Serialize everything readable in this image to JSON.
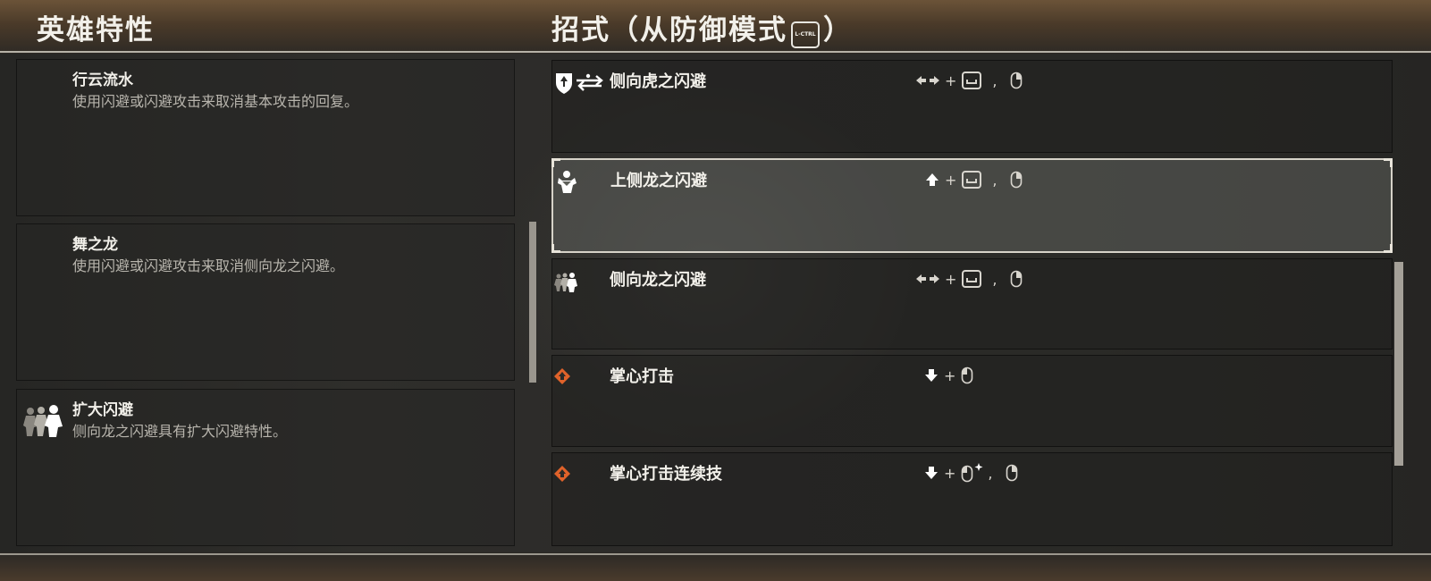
{
  "headers": {
    "traits_title": "英雄特性",
    "moves_title_prefix": "招式（从防御模式",
    "moves_title_key": "L-CTRL",
    "moves_title_suffix": "）"
  },
  "traits": [
    {
      "name": "行云流水",
      "description": "使用闪避或闪避攻击来取消基本攻击的回复。",
      "icon": ""
    },
    {
      "name": "舞之龙",
      "description": "使用闪避或闪避攻击来取消侧向龙之闪避。",
      "icon": ""
    },
    {
      "name": "扩大闪避",
      "description": "侧向龙之闪避具有扩大闪避特性。",
      "icon": "dodge-figures-icon"
    }
  ],
  "moves": [
    {
      "name": "侧向虎之闪避",
      "icon": "shield-dodge-icon",
      "inputs": "left-right-arrows + space-key , right-mouse-button",
      "highlighted": false
    },
    {
      "name": "上侧龙之闪避",
      "icon": "dragon-figure-icon",
      "inputs": "up-arrow + space-key , right-mouse-button",
      "highlighted": true
    },
    {
      "name": "侧向龙之闪避",
      "icon": "dodge-figures-icon",
      "inputs": "left-right-arrows + space-key , right-mouse-button",
      "highlighted": false
    },
    {
      "name": "掌心打击",
      "icon": "orange-palm-strike-icon",
      "inputs": "down-arrow + mouse-button",
      "highlighted": false
    },
    {
      "name": "掌心打击连续技",
      "icon": "orange-palm-strike-icon",
      "inputs": "down-arrow + mouse-button(hold) , right-mouse-button",
      "highlighted": false
    }
  ],
  "colors": {
    "accent_orange": "#e0622a",
    "header_text": "#f2f0ea",
    "description_text": "#b8b5ad"
  }
}
